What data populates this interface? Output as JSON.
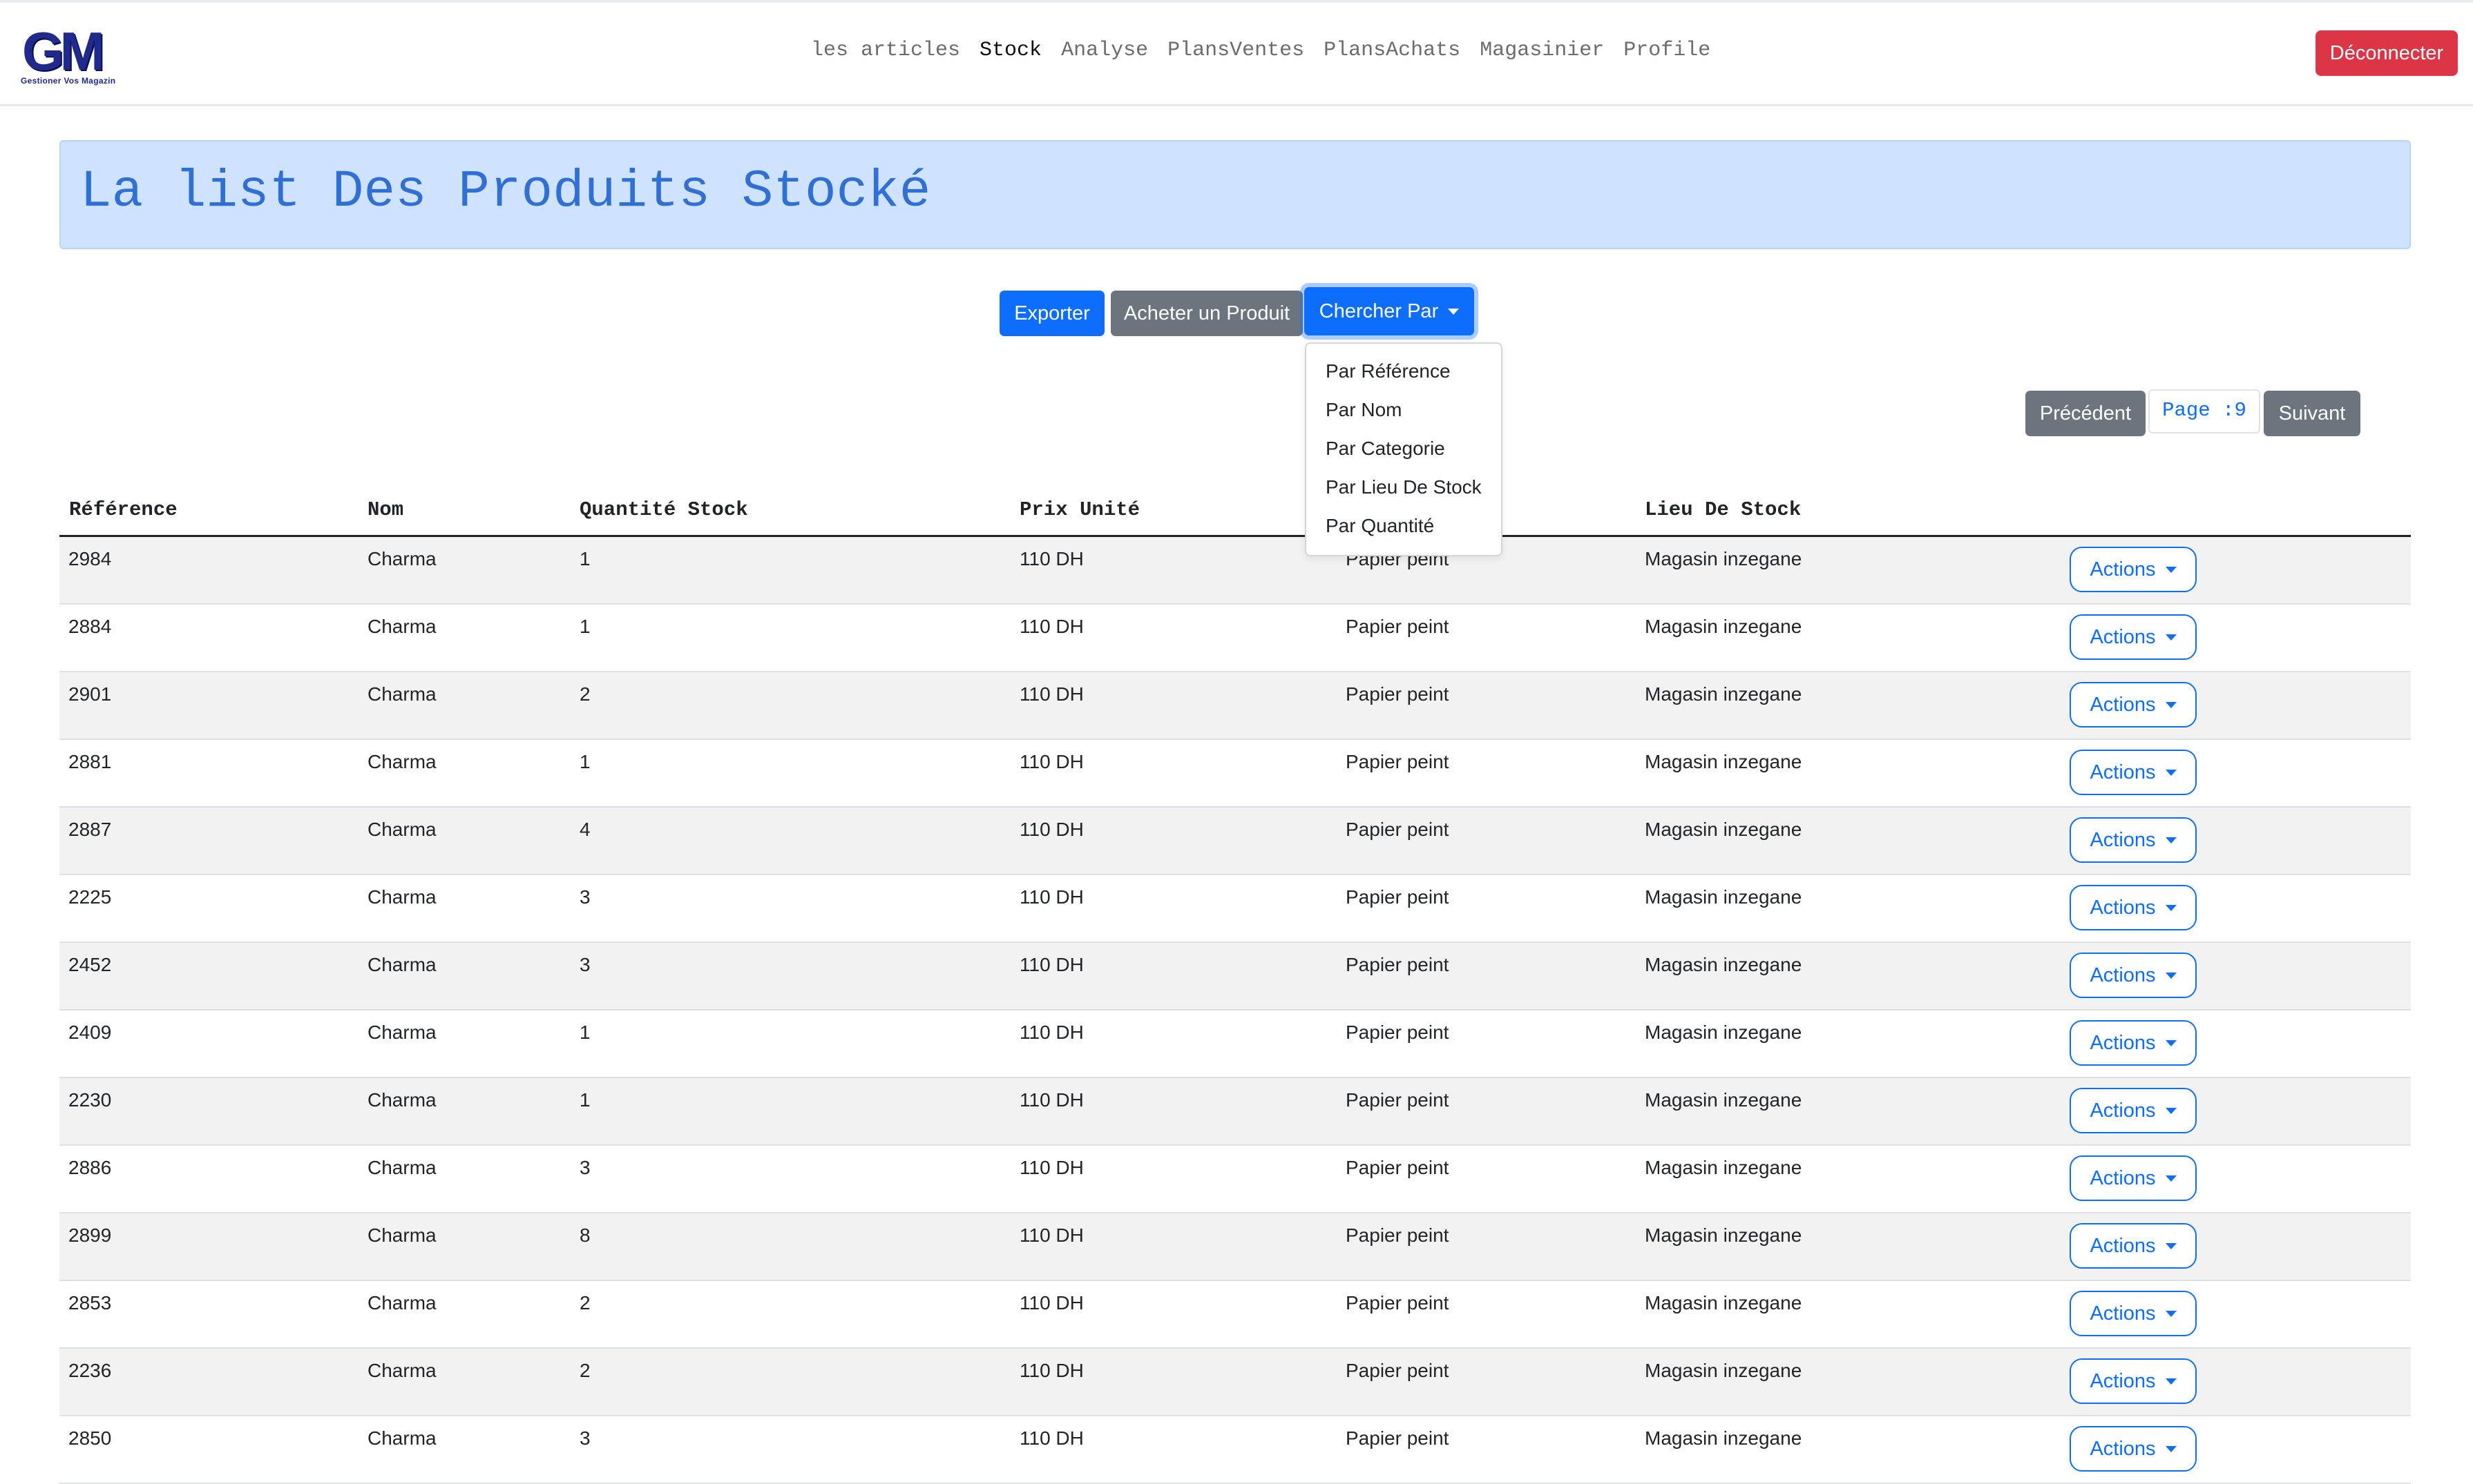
{
  "logo": {
    "letters": "GM",
    "subtitle": "Gestioner Vos Magazin"
  },
  "nav": {
    "links": [
      {
        "label": "les articles",
        "active": false
      },
      {
        "label": "Stock",
        "active": true
      },
      {
        "label": "Analyse",
        "active": false
      },
      {
        "label": "PlansVentes",
        "active": false
      },
      {
        "label": "PlansAchats",
        "active": false
      },
      {
        "label": "Magasinier",
        "active": false
      },
      {
        "label": "Profile",
        "active": false
      }
    ],
    "logout_label": "Déconnecter"
  },
  "page": {
    "title": "La list Des Produits Stocké"
  },
  "toolbar": {
    "export_label": "Exporter",
    "buy_label": "Acheter un Produit",
    "search_label": "Chercher Par"
  },
  "search_menu": {
    "items": [
      "Par Référence",
      "Par Nom",
      "Par Categorie",
      "Par Lieu De Stock",
      "Par Quantité"
    ]
  },
  "pager": {
    "prev_label": "Précédent",
    "page_label": "Page :9",
    "next_label": "Suivant"
  },
  "table": {
    "headers": [
      "Référence",
      "Nom",
      "Quantité Stock",
      "Prix Unité",
      "",
      "Lieu De Stock",
      ""
    ],
    "actions_label": "Actions",
    "rows": [
      {
        "ref": "2984",
        "nom": "Charma",
        "qty": "1",
        "prix": "110 DH",
        "cat": "Papier peint",
        "lieu": "Magasin inzegane"
      },
      {
        "ref": "2884",
        "nom": "Charma",
        "qty": "1",
        "prix": "110 DH",
        "cat": "Papier peint",
        "lieu": "Magasin inzegane"
      },
      {
        "ref": "2901",
        "nom": "Charma",
        "qty": "2",
        "prix": "110 DH",
        "cat": "Papier peint",
        "lieu": "Magasin inzegane"
      },
      {
        "ref": "2881",
        "nom": "Charma",
        "qty": "1",
        "prix": "110 DH",
        "cat": "Papier peint",
        "lieu": "Magasin inzegane"
      },
      {
        "ref": "2887",
        "nom": "Charma",
        "qty": "4",
        "prix": "110 DH",
        "cat": "Papier peint",
        "lieu": "Magasin inzegane"
      },
      {
        "ref": "2225",
        "nom": "Charma",
        "qty": "3",
        "prix": "110 DH",
        "cat": "Papier peint",
        "lieu": "Magasin inzegane"
      },
      {
        "ref": "2452",
        "nom": "Charma",
        "qty": "3",
        "prix": "110 DH",
        "cat": "Papier peint",
        "lieu": "Magasin inzegane"
      },
      {
        "ref": "2409",
        "nom": "Charma",
        "qty": "1",
        "prix": "110 DH",
        "cat": "Papier peint",
        "lieu": "Magasin inzegane"
      },
      {
        "ref": "2230",
        "nom": "Charma",
        "qty": "1",
        "prix": "110 DH",
        "cat": "Papier peint",
        "lieu": "Magasin inzegane"
      },
      {
        "ref": "2886",
        "nom": "Charma",
        "qty": "3",
        "prix": "110 DH",
        "cat": "Papier peint",
        "lieu": "Magasin inzegane"
      },
      {
        "ref": "2899",
        "nom": "Charma",
        "qty": "8",
        "prix": "110 DH",
        "cat": "Papier peint",
        "lieu": "Magasin inzegane"
      },
      {
        "ref": "2853",
        "nom": "Charma",
        "qty": "2",
        "prix": "110 DH",
        "cat": "Papier peint",
        "lieu": "Magasin inzegane"
      },
      {
        "ref": "2236",
        "nom": "Charma",
        "qty": "2",
        "prix": "110 DH",
        "cat": "Papier peint",
        "lieu": "Magasin inzegane"
      },
      {
        "ref": "2850",
        "nom": "Charma",
        "qty": "3",
        "prix": "110 DH",
        "cat": "Papier peint",
        "lieu": "Magasin inzegane"
      }
    ]
  }
}
